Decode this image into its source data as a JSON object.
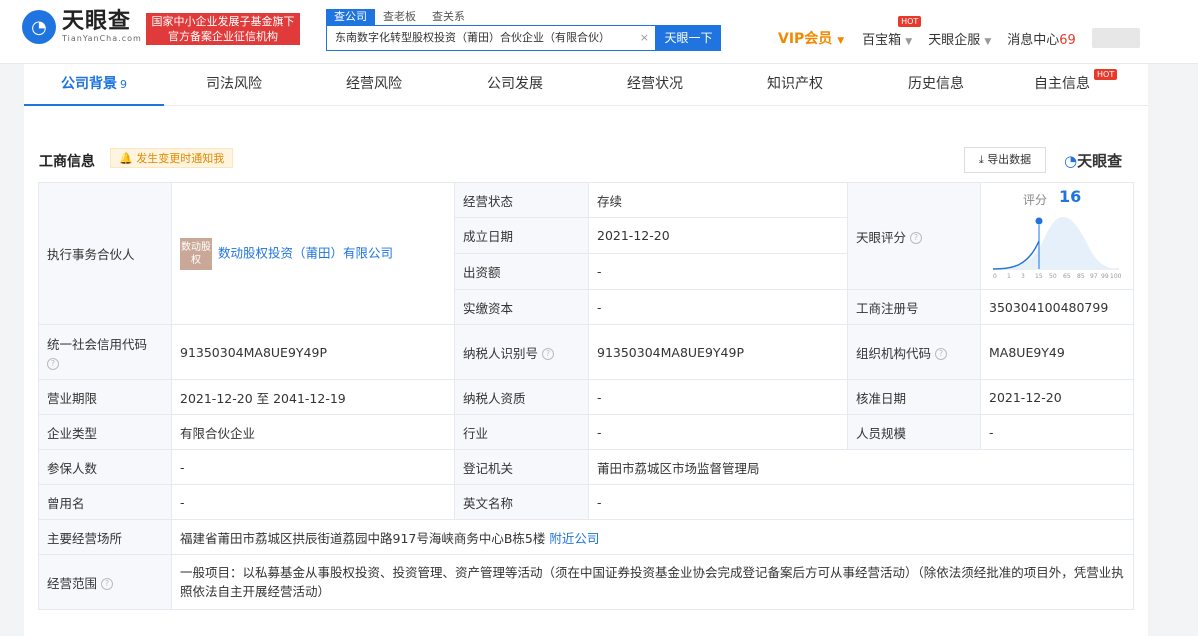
{
  "header": {
    "logo_cn": "天眼查",
    "logo_en": "TianYanCha.com",
    "gov_line1": "国家中小企业发展子基金旗下",
    "gov_line2": "官方备案企业征信机构",
    "search_tabs": [
      "查公司",
      "查老板",
      "查关系"
    ],
    "search_value": "东南数字化转型股权投资（莆田）合伙企业（有限合伙）",
    "search_btn": "天眼一下",
    "vip": "VIP会员",
    "baobaoxiang": "百宝箱",
    "qiyun": "天眼企服",
    "msg": "消息中心",
    "msg_count": "69",
    "hot": "HOT"
  },
  "tabs": [
    {
      "label": "公司背景",
      "count": "9"
    },
    {
      "label": "司法风险"
    },
    {
      "label": "经营风险"
    },
    {
      "label": "公司发展"
    },
    {
      "label": "经营状况"
    },
    {
      "label": "知识产权"
    },
    {
      "label": "历史信息"
    },
    {
      "label": "自主信息"
    }
  ],
  "section": {
    "title": "工商信息",
    "notify": "发生变更时通知我",
    "export": "导出数据",
    "brand": "天眼查"
  },
  "info": {
    "partner_label": "执行事务合伙人",
    "partner_logo": "数动股权",
    "partner_name": "数动股权投资（莆田）有限公司",
    "status_label": "经营状态",
    "status": "存续",
    "founded_label": "成立日期",
    "founded": "2021-12-20",
    "capital_label": "出资额",
    "capital": "-",
    "paid_label": "实缴资本",
    "paid": "-",
    "score_label_cell": "天眼评分",
    "score_text": "评分",
    "score": "16",
    "reg_no_label": "工商注册号",
    "reg_no": "350304100480799",
    "credit_label": "统一社会信用代码",
    "credit": "91350304MA8UE9Y49P",
    "tax_label": "纳税人识别号",
    "tax": "91350304MA8UE9Y49P",
    "org_label": "组织机构代码",
    "org": "MA8UE9Y49",
    "term_label": "营业期限",
    "term": "2021-12-20  至 2041-12-19",
    "taxq_label": "纳税人资质",
    "taxq": "-",
    "approve_label": "核准日期",
    "approve": "2021-12-20",
    "type_label": "企业类型",
    "type": "有限合伙企业",
    "industry_label": "行业",
    "industry": "-",
    "staff_label": "人员规模",
    "staff": "-",
    "insured_label": "参保人数",
    "insured": "-",
    "authority_label": "登记机关",
    "authority": "莆田市荔城区市场监督管理局",
    "former_label": "曾用名",
    "former": "-",
    "en_label": "英文名称",
    "en": "-",
    "address_label": "主要经营场所",
    "address": "福建省莆田市荔城区拱辰街道荔园中路917号海峡商务中心B栋5楼",
    "nearby": "附近公司",
    "scope_label": "经营范围",
    "scope": "一般项目：以私募基金从事股权投资、投资管理、资产管理等活动（须在中国证券投资基金业协会完成登记备案后方可从事经营活动）（除依法须经批准的项目外，凭营业执照依法自主开展经营活动）",
    "curve_ticks": [
      "0",
      "1",
      "3",
      "15",
      "50",
      "65",
      "85",
      "97",
      "99",
      "100"
    ]
  }
}
